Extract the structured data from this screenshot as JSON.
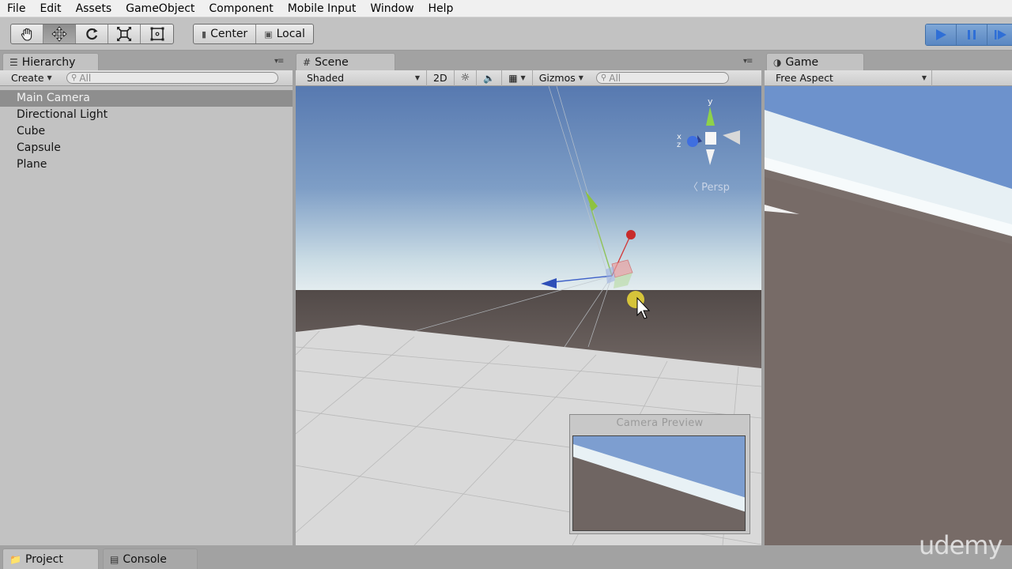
{
  "menu": [
    "File",
    "Edit",
    "Assets",
    "GameObject",
    "Component",
    "Mobile Input",
    "Window",
    "Help"
  ],
  "toolbar": {
    "transform_tools": [
      "hand-tool",
      "move-tool",
      "rotate-tool",
      "scale-tool",
      "rect-tool"
    ],
    "active_tool": "move-tool",
    "pivot_mode": "Center",
    "pivot_rotation": "Local",
    "play_controls": [
      "play",
      "pause",
      "step"
    ],
    "playing": true
  },
  "hierarchy": {
    "tab_label": "Hierarchy",
    "create_label": "Create",
    "search_placeholder": "All",
    "items": [
      {
        "label": "Main Camera",
        "selected": true
      },
      {
        "label": "Directional Light",
        "selected": false
      },
      {
        "label": "Cube",
        "selected": false
      },
      {
        "label": "Capsule",
        "selected": false
      },
      {
        "label": "Plane",
        "selected": false
      }
    ]
  },
  "scene": {
    "tab_label": "Scene",
    "shading_mode": "Shaded",
    "mode_2d_label": "2D",
    "gizmos_label": "Gizmos",
    "search_placeholder": "All",
    "projection_label": "Persp",
    "axis_labels": {
      "y": "y",
      "x": "x",
      "z": "z"
    },
    "camera_preview_title": "Camera Preview"
  },
  "game": {
    "tab_label": "Game",
    "aspect_label": "Free Aspect"
  },
  "bottom_tabs": [
    "Project",
    "Console"
  ],
  "watermark": "udemy",
  "colors": {
    "panel_bg": "#c2c2c2",
    "play_active": "#5a87c2",
    "selection": "#8e8e8e",
    "sky_top": "#5b7fb5",
    "horizon": "#dfe9ee",
    "ground": "#776b67",
    "grid_plane": "#d8d8d8"
  }
}
